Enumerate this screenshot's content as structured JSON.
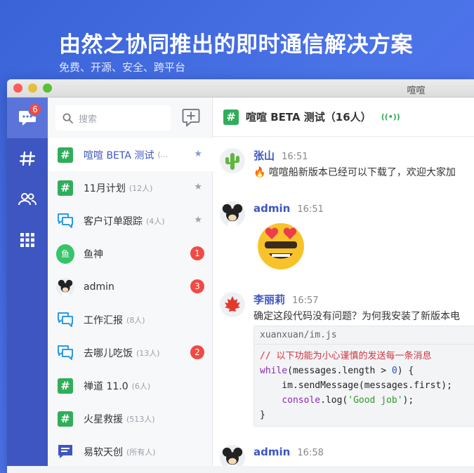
{
  "hero": {
    "title": "由然之协同推出的即时通信解决方案",
    "subtitle": "免费、开源、安全、跨平台"
  },
  "window": {
    "title": "喧喧"
  },
  "nav": {
    "items": [
      {
        "icon": "chat-bubble-icon",
        "badge": "6",
        "active": true
      },
      {
        "icon": "hash-icon"
      },
      {
        "icon": "contacts-icon"
      },
      {
        "icon": "apps-grid-icon"
      }
    ]
  },
  "search": {
    "placeholder": "搜索"
  },
  "conversations": [
    {
      "icon": "hash",
      "name": "喧喧 BETA 测试",
      "count": "(...",
      "star": true,
      "active": true
    },
    {
      "icon": "hash",
      "name": "11月计划",
      "count": "(12人)",
      "star": true
    },
    {
      "icon": "chat",
      "name": "客户订单跟踪",
      "count": "(4人)",
      "star": true
    },
    {
      "icon": "avatar-green",
      "avatar_text": "鱼",
      "name": "鱼神",
      "count": "",
      "badge": "1"
    },
    {
      "icon": "avatar-mouse",
      "name": "admin",
      "count": "",
      "badge": "3"
    },
    {
      "icon": "chat",
      "name": "工作汇报",
      "count": "(8人)"
    },
    {
      "icon": "chat",
      "name": "去哪儿吃饭",
      "count": "(13人)",
      "badge": "2"
    },
    {
      "icon": "hash",
      "name": "禅道 11.0",
      "count": "(6人)"
    },
    {
      "icon": "hash",
      "name": "火星救援",
      "count": "(513人)"
    },
    {
      "icon": "doc",
      "name": "易软天创",
      "count": "(所有人)"
    }
  ],
  "chat": {
    "title": "喧喧 BETA 测试（16人）",
    "live_icon": "broadcast-icon",
    "messages": [
      {
        "user": "张山",
        "time": "16:51",
        "avatar": "cactus",
        "text": "喧喧船新版本已经可以下载了，欢迎大家加"
      },
      {
        "user": "admin",
        "time": "16:51",
        "avatar": "mouse",
        "emoji": "heart-eyes-sunglasses"
      },
      {
        "user": "李丽莉",
        "time": "16:57",
        "avatar": "maple-leaf",
        "text": "确定这段代码没有问题？为何我安装了新版本电",
        "code": {
          "file": "xuanxuan/im.js",
          "comment": "// 以下功能为小心谨慎的发送每一条消息",
          "line2_kw": "while",
          "line2_a": "(messages.length > ",
          "line2_num": "0",
          "line2_b": ") {",
          "line3": "    im.sendMessage(messages.first);",
          "line4_a": "    ",
          "line4_kw": "console",
          "line4_b": ".log(",
          "line4_str": "'Good job'",
          "line4_c": ");",
          "line5": "}"
        }
      },
      {
        "user": "admin",
        "time": "16:58",
        "avatar": "mouse"
      }
    ]
  },
  "colors": {
    "brand": "#3d56c2",
    "green": "#2fae5a",
    "badge": "#f04a45"
  }
}
